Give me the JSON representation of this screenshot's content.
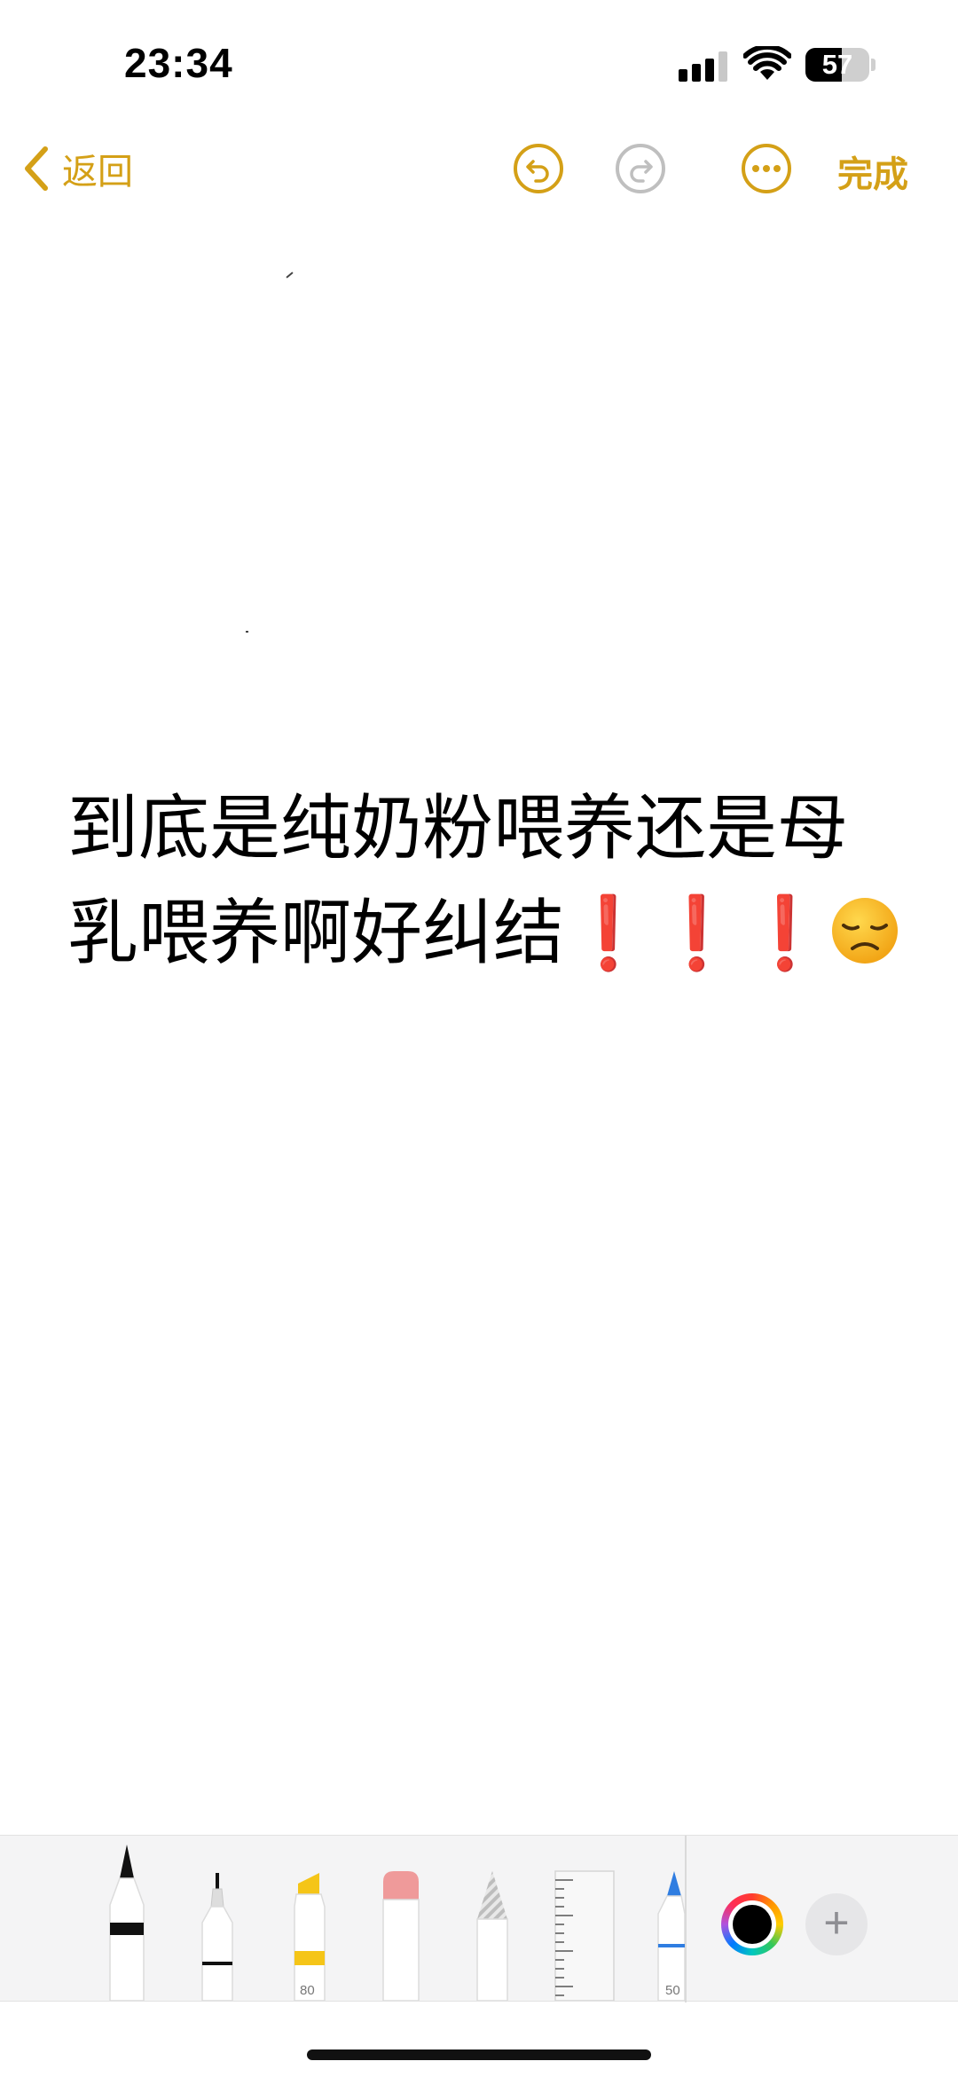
{
  "status_bar": {
    "time": "23:34",
    "battery_percent": "57",
    "battery_level": 0.57,
    "signal_bars_filled": 3,
    "signal_bars_total": 4
  },
  "nav": {
    "back_label": "返回",
    "done_label": "完成",
    "accent_color": "#D4A017",
    "disabled_color": "#BFBFBF"
  },
  "note": {
    "line1": "到底是纯奶粉喂养还是母",
    "line2_text": "乳喂养啊好纠结",
    "exclamations": "❗❗❗"
  },
  "tools": {
    "highlighter_size": "80",
    "marker_size": "50",
    "selected_color": "#000000",
    "add_label": "+"
  },
  "icons": {
    "back": "chevron-left-icon",
    "undo": "undo-icon",
    "redo": "redo-icon",
    "more": "ellipsis-icon",
    "emoji": "disappointed-face-emoji"
  }
}
